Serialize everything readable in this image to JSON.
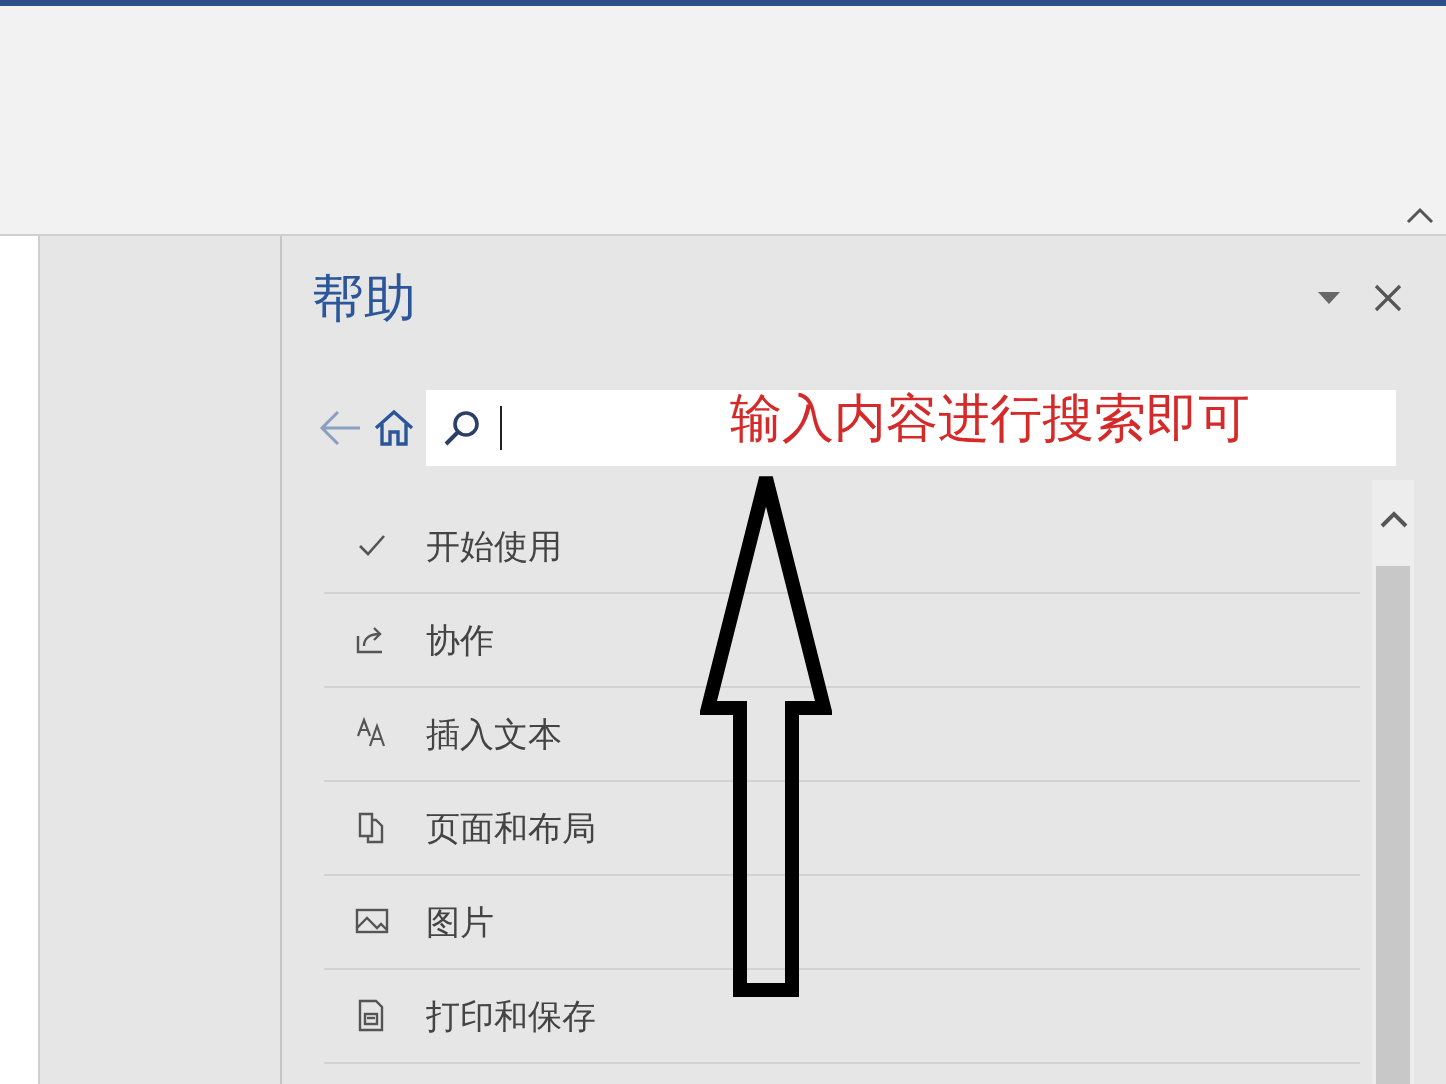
{
  "pane": {
    "title": "帮助"
  },
  "annotation": {
    "text": "输入内容进行搜索即可"
  },
  "topics": [
    {
      "label": "开始使用"
    },
    {
      "label": "协作"
    },
    {
      "label": "插入文本"
    },
    {
      "label": "页面和布局"
    },
    {
      "label": "图片"
    },
    {
      "label": "打印和保存"
    }
  ]
}
